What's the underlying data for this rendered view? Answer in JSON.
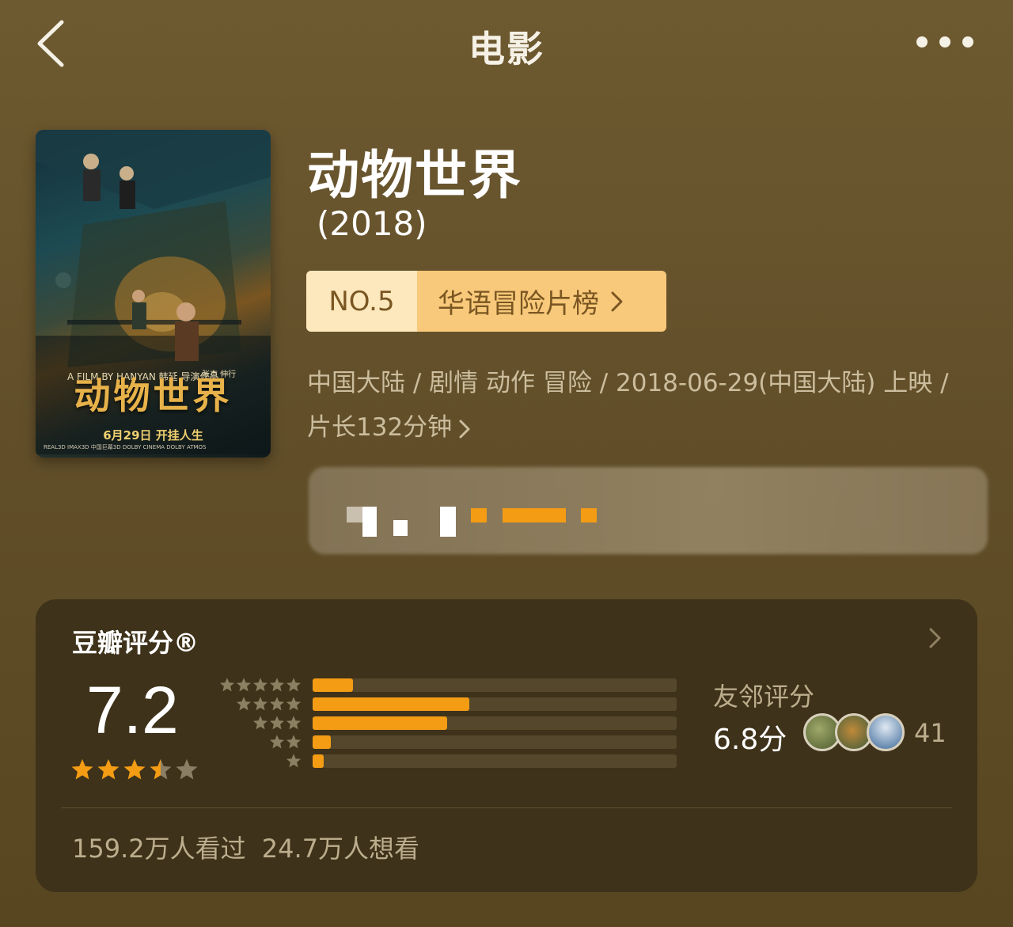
{
  "nav": {
    "title": "电影",
    "back_icon": "chevron-left-icon",
    "more_icon": "more-dots-icon"
  },
  "poster": {
    "title": "动物世界",
    "credit": "A FILM BY HANYAN 韩延 导演作品",
    "credit2": "张杰 伸行",
    "date_line": "6月29日 开挂人生",
    "logos": "REAL3D IMAX3D 中国巨幕3D DOLBY CINEMA DOLBY ATMOS"
  },
  "movie": {
    "title": "动物世界",
    "year": "(2018)",
    "rank_no": "NO.5",
    "rank_list": "华语冒险片榜",
    "meta_line": "中国大陆 / 剧情 动作 冒险 / 2018-06-29(中国大陆) 上映 / 片长132分钟"
  },
  "rating": {
    "title": "豆瓣评分®",
    "score": "7.2",
    "stars_value": 3.5,
    "stars_max": 5,
    "distribution": [
      {
        "stars": 5,
        "fraction": 0.11
      },
      {
        "stars": 4,
        "fraction": 0.43
      },
      {
        "stars": 3,
        "fraction": 0.37
      },
      {
        "stars": 2,
        "fraction": 0.05
      },
      {
        "stars": 1,
        "fraction": 0.03
      }
    ],
    "friend_label": "友邻评分",
    "friend_score": "6.8分",
    "friend_count": "41",
    "watched": "159.2万人看过",
    "wish": "24.7万人想看"
  },
  "colors": {
    "accent": "#f39c14",
    "badge_left": "#fde8bd",
    "badge_right": "#f8c97a",
    "card_bg": "#3e321a"
  }
}
